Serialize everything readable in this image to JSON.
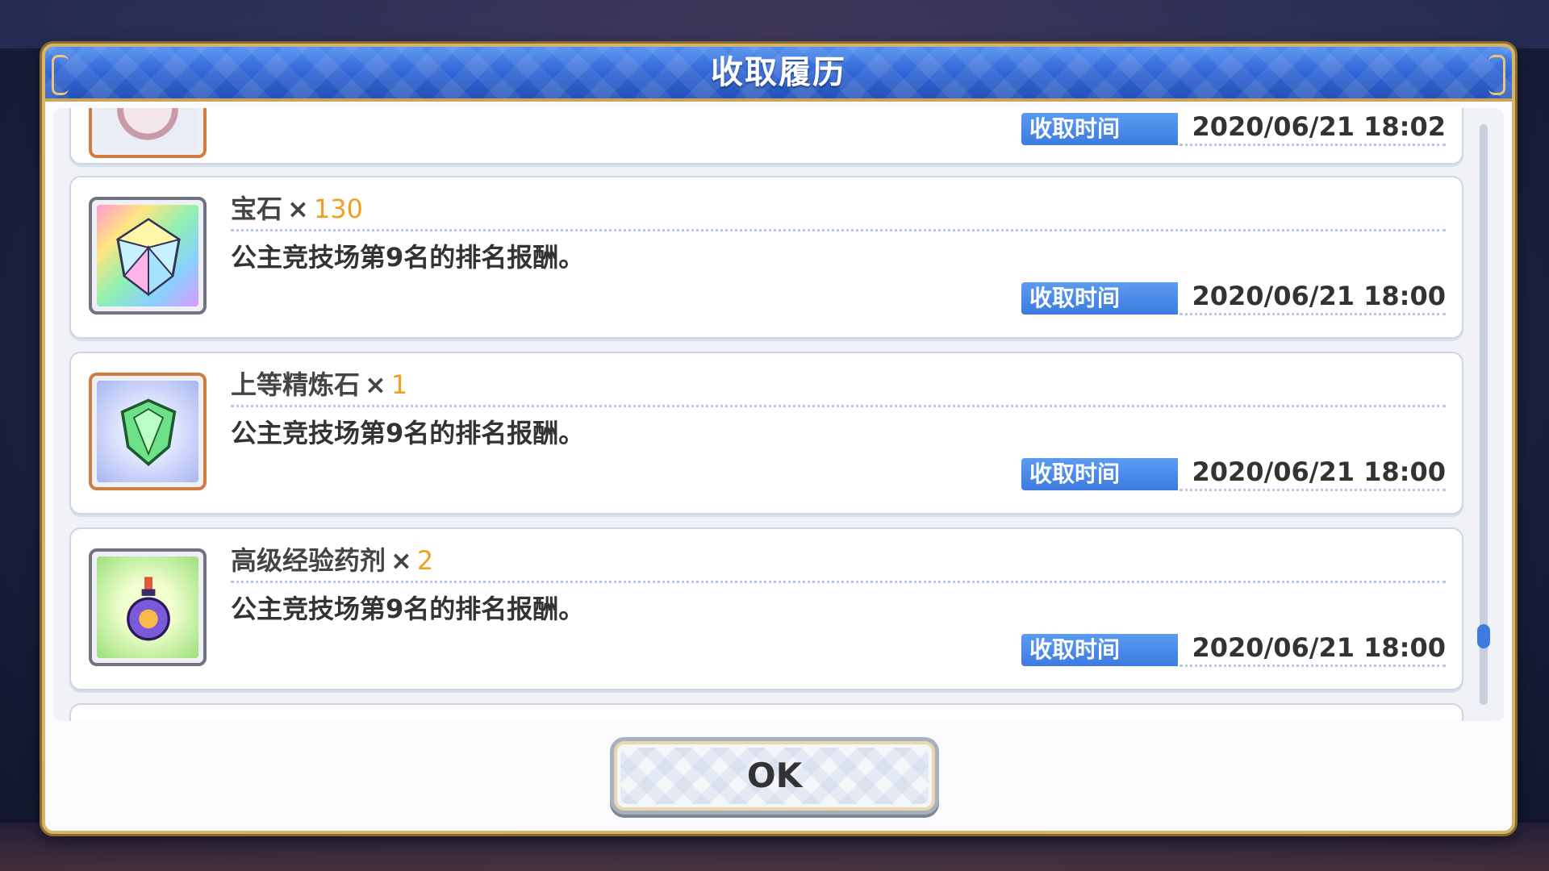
{
  "dialog": {
    "title": "收取履历",
    "ok_label": "OK"
  },
  "entries": [
    {
      "icon": "bottle-item-icon",
      "time_label": "收取时间",
      "time": "2020/06/21 18:02"
    },
    {
      "icon": "rainbow-gem-icon",
      "name": "宝石",
      "times": "×",
      "qty": "130",
      "desc": "公主竞技场第9名的排名报酬。",
      "time_label": "收取时间",
      "time": "2020/06/21 18:00"
    },
    {
      "icon": "green-refine-stone-icon",
      "name": "上等精炼石",
      "times": "×",
      "qty": "1",
      "desc": "公主竞技场第9名的排名报酬。",
      "time_label": "收取时间",
      "time": "2020/06/21 18:00"
    },
    {
      "icon": "exp-potion-icon",
      "name": "高级经验药剂",
      "times": "×",
      "qty": "2",
      "desc": "公主竞技场第9名的排名报酬。",
      "time_label": "收取时间",
      "time": "2020/06/21 18:00"
    }
  ],
  "colors": {
    "title_bar": "#2f63d2",
    "quantity": "#f0a020",
    "time_label_bg": "#3d7be0"
  }
}
